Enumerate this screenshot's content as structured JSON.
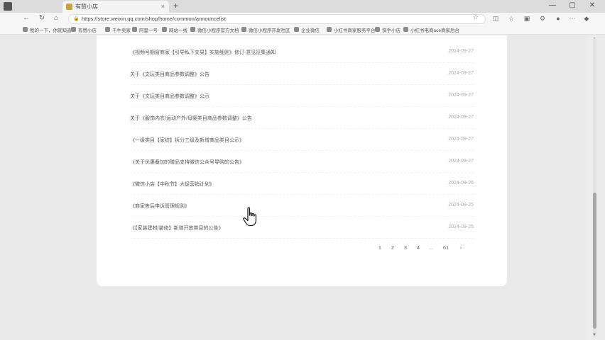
{
  "browser": {
    "tab_title": "有赞小店",
    "tab_close": "×",
    "new_tab": "+",
    "url": "https://store.weixin.qq.com/shop/home/common/announcelist",
    "win_min": "—",
    "win_max": "▢",
    "win_close": "✕",
    "bookmarks": [
      "我的一下，你就知道",
      "有赞小店",
      "千牛卖家",
      "阿里一号",
      "网站一线",
      "微信小程序官方文档",
      "微信小程序开发社区",
      "企业微信",
      "小红书商家服务平台",
      "快手小店",
      "小红书电商ace商家后台"
    ]
  },
  "announcements": [
    {
      "title": "《视频号橱窗商家【引导私下交易】实施细则》修订-意见征集通知",
      "date": "2024-09-27"
    },
    {
      "title": "关于《文玩类目商品参数调整》公告",
      "date": "2024-09-27"
    },
    {
      "title": "关于《文玩类目商品参数调整》公示",
      "date": "2024-09-27"
    },
    {
      "title": "关于《服饰内衣/运动户外/母婴类目商品参数调整》公告",
      "date": "2024-09-27"
    },
    {
      "title": "《一级类目【家纺】拆分三级及新增商品类目公示》",
      "date": "2024-09-27"
    },
    {
      "title": "《关于优惠叠加的赠品支持微信公众号导购的公告》",
      "date": "2024-09-27"
    },
    {
      "title": "《微信小店【中秋节】大促营销计划》",
      "date": "2024-09-26"
    },
    {
      "title": "《商家售后申诉管理规则》",
      "date": "2024-09-25"
    },
    {
      "title": "《【家装建材/装修】新增开放类目的公告》",
      "date": "2024-09-25"
    }
  ],
  "pagination": [
    "1",
    "2",
    "3",
    "4",
    "...",
    "61",
    "›"
  ]
}
